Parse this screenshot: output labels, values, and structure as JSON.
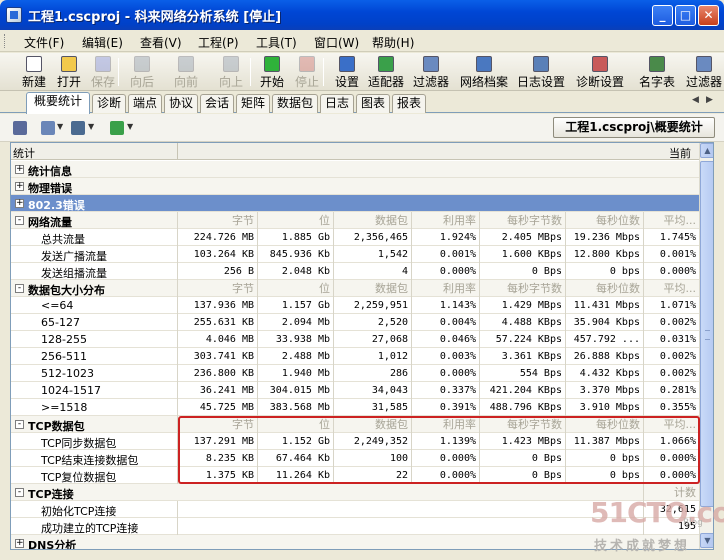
{
  "window": {
    "title": "工程1.cscproj - 科来网络分析系统 [停止]",
    "btn_min": "_",
    "btn_max": "□",
    "btn_close": "✕"
  },
  "menu": [
    "文件(F)",
    "编辑(E)",
    "查看(V)",
    "工程(P)",
    "工具(T)",
    "窗口(W)",
    "帮助(H)"
  ],
  "toolbar": [
    {
      "label": "新建",
      "icon": "new-file-icon",
      "color": "#ffffff",
      "enabled": true
    },
    {
      "label": "打开",
      "icon": "open-folder-icon",
      "color": "#f2c94c",
      "enabled": true
    },
    {
      "label": "保存",
      "icon": "save-icon",
      "color": "#6a7ad8",
      "enabled": false
    },
    {
      "label": "向后",
      "icon": "back-arrow-icon",
      "color": "#7a8aa0",
      "enabled": false
    },
    {
      "label": "向前",
      "icon": "forward-arrow-icon",
      "color": "#7a8aa0",
      "enabled": false
    },
    {
      "label": "向上",
      "icon": "up-arrow-icon",
      "color": "#7a8aa0",
      "enabled": false
    },
    {
      "label": "开始",
      "icon": "start-icon",
      "color": "#2fb23a",
      "enabled": true
    },
    {
      "label": "停止",
      "icon": "stop-icon",
      "color": "#c0504d",
      "enabled": false
    },
    {
      "label": "设置",
      "icon": "settings-icon",
      "color": "#3a6fc8",
      "enabled": true
    },
    {
      "label": "适配器",
      "icon": "adapter-icon",
      "color": "#3aa04a",
      "enabled": true
    },
    {
      "label": "过滤器",
      "icon": "filter-icon",
      "color": "#6a8ac0",
      "enabled": true
    },
    {
      "label": "网络档案",
      "icon": "network-profile-icon",
      "color": "#4a78c0",
      "enabled": true
    },
    {
      "label": "日志设置",
      "icon": "log-settings-icon",
      "color": "#5a80b8",
      "enabled": true
    },
    {
      "label": "诊断设置",
      "icon": "diagnosis-settings-icon",
      "color": "#c85a5a",
      "enabled": true
    },
    {
      "label": "名字表",
      "icon": "name-table-icon",
      "color": "#4a8a4a",
      "enabled": true
    },
    {
      "label": "过滤器",
      "icon": "filter2-icon",
      "color": "#6a8ac0",
      "enabled": true
    }
  ],
  "tabs": [
    "概要统计",
    "诊断",
    "端点",
    "协议",
    "会话",
    "矩阵",
    "数据包",
    "日志",
    "图表",
    "报表"
  ],
  "active_tab": 0,
  "path_label": "工程1.cscproj\\概要统计",
  "grid": {
    "col_stat": "统计",
    "col_current": "当前",
    "metric_headers": [
      "字节",
      "位",
      "数据包",
      "利用率",
      "每秒字节数",
      "每秒位数",
      "平均..."
    ],
    "rows": [
      {
        "kind": "group",
        "expander": "+",
        "name": "统计信息"
      },
      {
        "kind": "group",
        "expander": "+",
        "name": "物理错误"
      },
      {
        "kind": "selected",
        "expander": "+",
        "name": "802.3错误"
      },
      {
        "kind": "header",
        "expander": "-",
        "name": "网络流量"
      },
      {
        "kind": "data",
        "name": "总共流量",
        "vals": [
          "224.726 MB",
          "1.885 Gb",
          "2,356,465",
          "1.924%",
          "2.405 MBps",
          "19.236 Mbps",
          "1.745%"
        ]
      },
      {
        "kind": "data",
        "name": "发送广播流量",
        "vals": [
          "103.264 KB",
          "845.936 Kb",
          "1,542",
          "0.001%",
          "1.600 KBps",
          "12.800 Kbps",
          "0.001%"
        ]
      },
      {
        "kind": "data",
        "name": "发送组播流量",
        "vals": [
          "256 B",
          "2.048 Kb",
          "4",
          "0.000%",
          "0 Bps",
          "0 bps",
          "0.000%"
        ]
      },
      {
        "kind": "header",
        "expander": "-",
        "name": "数据包大小分布"
      },
      {
        "kind": "data",
        "name": "<=64",
        "vals": [
          "137.936 MB",
          "1.157 Gb",
          "2,259,951",
          "1.143%",
          "1.429 MBps",
          "11.431 Mbps",
          "1.071%"
        ]
      },
      {
        "kind": "data",
        "name": "65-127",
        "vals": [
          "255.631 KB",
          "2.094 Mb",
          "2,520",
          "0.004%",
          "4.488 KBps",
          "35.904 Kbps",
          "0.002%"
        ]
      },
      {
        "kind": "data",
        "name": "128-255",
        "vals": [
          "4.046 MB",
          "33.938 Mb",
          "27,068",
          "0.046%",
          "57.224 KBps",
          "457.792 ...",
          "0.031%"
        ]
      },
      {
        "kind": "data",
        "name": "256-511",
        "vals": [
          "303.741 KB",
          "2.488 Mb",
          "1,012",
          "0.003%",
          "3.361 KBps",
          "26.888 Kbps",
          "0.002%"
        ]
      },
      {
        "kind": "data",
        "name": "512-1023",
        "vals": [
          "236.800 KB",
          "1.940 Mb",
          "286",
          "0.000%",
          "554 Bps",
          "4.432 Kbps",
          "0.002%"
        ]
      },
      {
        "kind": "data",
        "name": "1024-1517",
        "vals": [
          "36.241 MB",
          "304.015 Mb",
          "34,043",
          "0.337%",
          "421.204 KBps",
          "3.370 Mbps",
          "0.281%"
        ]
      },
      {
        "kind": "data",
        "name": ">=1518",
        "vals": [
          "45.725 MB",
          "383.568 Mb",
          "31,585",
          "0.391%",
          "488.796 KBps",
          "3.910 Mbps",
          "0.355%"
        ]
      },
      {
        "kind": "header",
        "expander": "-",
        "name": "TCP数据包"
      },
      {
        "kind": "data",
        "name": "TCP同步数据包",
        "vals": [
          "137.291 MB",
          "1.152 Gb",
          "2,249,352",
          "1.139%",
          "1.423 MBps",
          "11.387 Mbps",
          "1.066%"
        ]
      },
      {
        "kind": "data",
        "name": "TCP结束连接数据包",
        "vals": [
          "8.235 KB",
          "67.464 Kb",
          "100",
          "0.000%",
          "0 Bps",
          "0 bps",
          "0.000%"
        ]
      },
      {
        "kind": "data",
        "name": "TCP复位数据包",
        "vals": [
          "1.375 KB",
          "11.264 Kb",
          "22",
          "0.000%",
          "0 Bps",
          "0 bps",
          "0.000%"
        ]
      },
      {
        "kind": "header-count",
        "expander": "-",
        "name": "TCP连接",
        "count_label": "计数"
      },
      {
        "kind": "count",
        "name": "初始化TCP连接",
        "count": "32,615"
      },
      {
        "kind": "count",
        "name": "成功建立的TCP连接",
        "count": "195"
      },
      {
        "kind": "group",
        "expander": "+",
        "name": "DNS分析"
      }
    ]
  },
  "watermark": {
    "line1": "51CTO.com",
    "line2": "技术成就梦想",
    "line3": "Blog"
  }
}
